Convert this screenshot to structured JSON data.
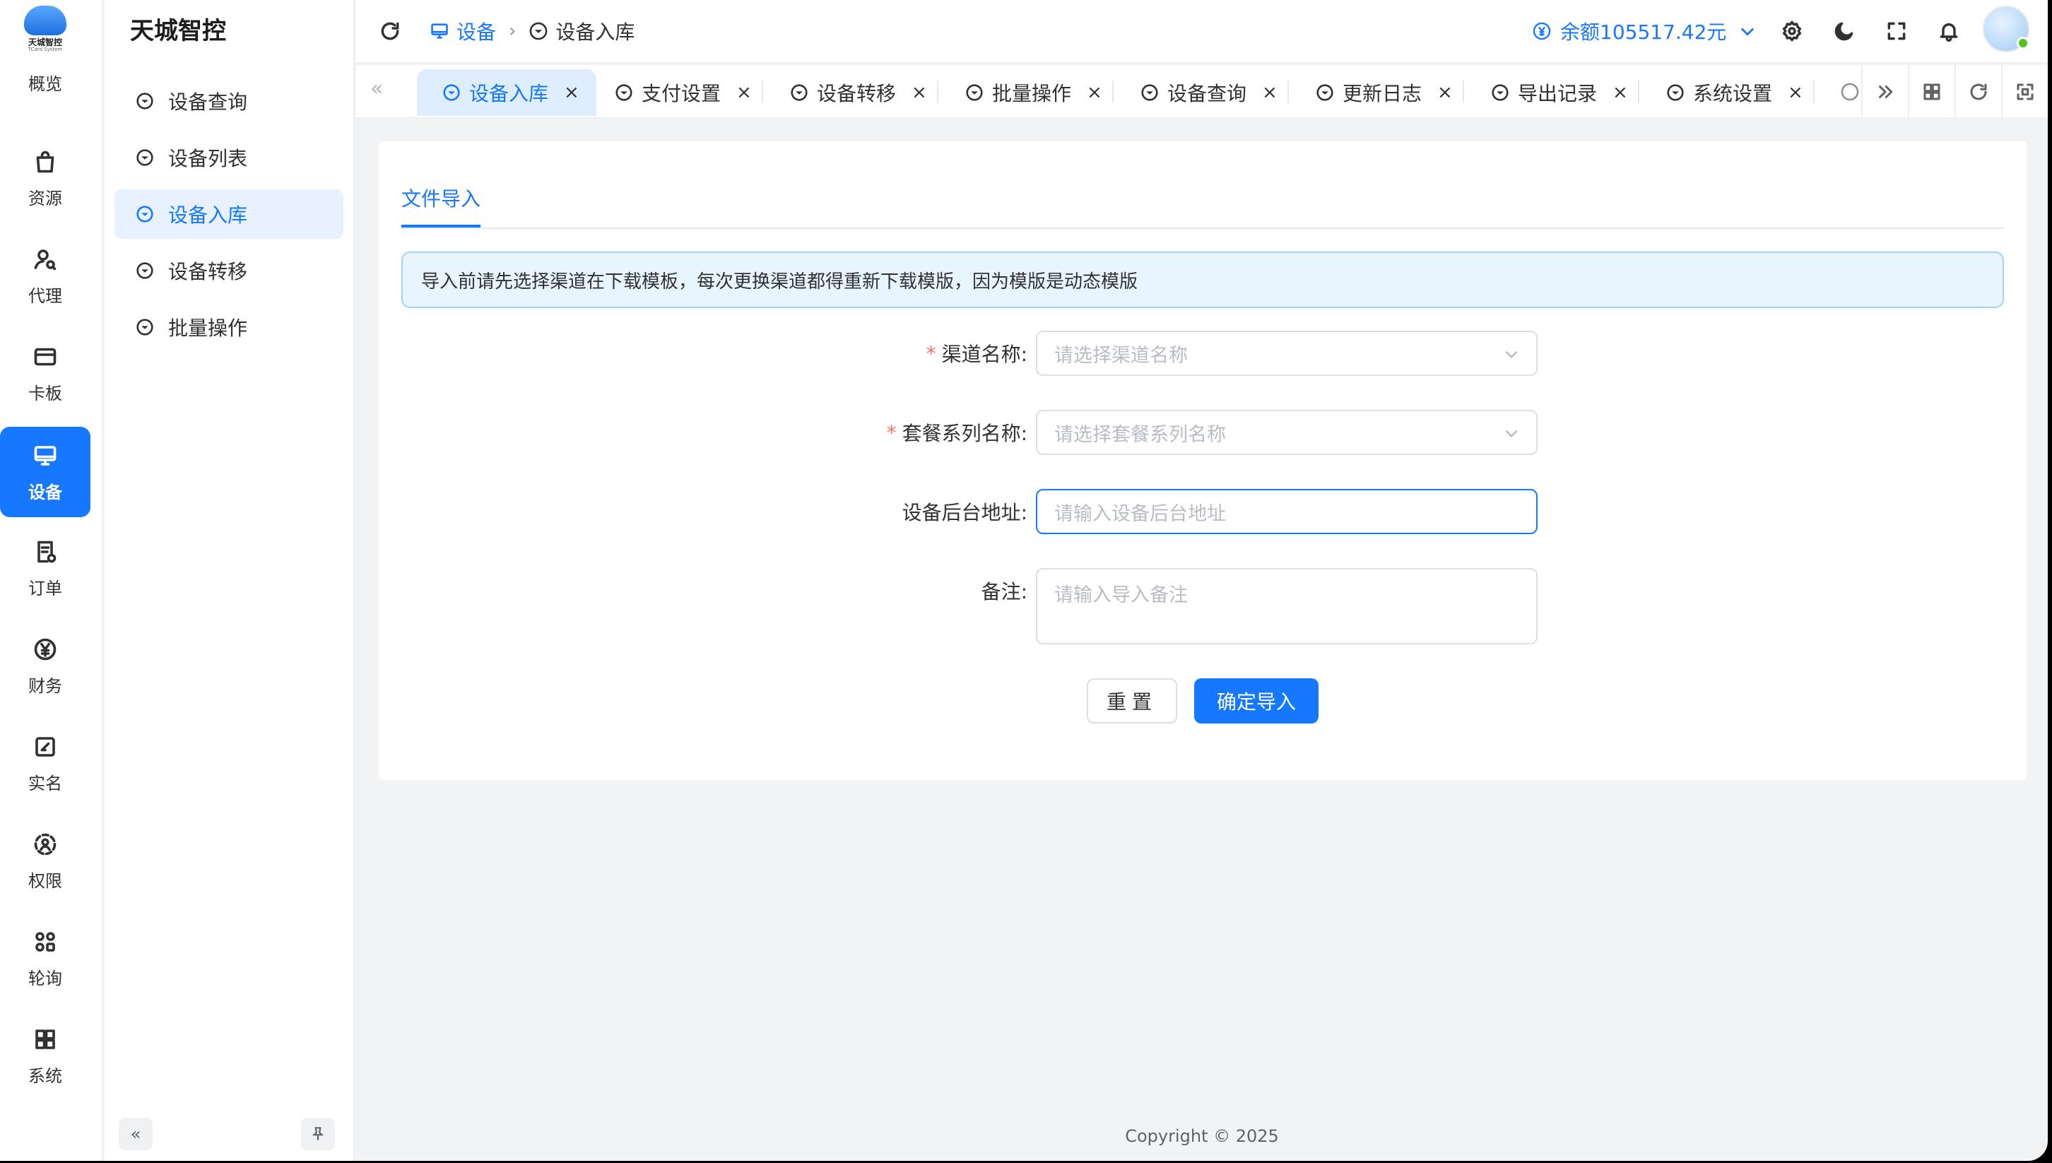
{
  "logo": {
    "title": "天城智控",
    "subtitle": "TCard System"
  },
  "rail": {
    "items": [
      {
        "label": "概览",
        "icon": "overview-icon"
      },
      {
        "label": "资源",
        "icon": "bag-icon"
      },
      {
        "label": "代理",
        "icon": "agent-icon"
      },
      {
        "label": "卡板",
        "icon": "card-icon"
      },
      {
        "label": "设备",
        "icon": "monitor-icon",
        "active": true
      },
      {
        "label": "订单",
        "icon": "order-icon"
      },
      {
        "label": "财务",
        "icon": "yen-icon"
      },
      {
        "label": "实名",
        "icon": "edit-icon"
      },
      {
        "label": "权限",
        "icon": "permission-icon"
      },
      {
        "label": "轮询",
        "icon": "poll-icon"
      },
      {
        "label": "系统",
        "icon": "grid-icon"
      }
    ]
  },
  "sidebar": {
    "brand": "天城智控",
    "items": [
      {
        "label": "设备查询"
      },
      {
        "label": "设备列表"
      },
      {
        "label": "设备入库",
        "active": true
      },
      {
        "label": "设备转移"
      },
      {
        "label": "批量操作"
      }
    ]
  },
  "header": {
    "breadcrumb": {
      "root": "设备",
      "current": "设备入库"
    },
    "balance": "余额105517.42元"
  },
  "tabs": [
    {
      "label": "设备入库",
      "active": true
    },
    {
      "label": "支付设置"
    },
    {
      "label": "设备转移"
    },
    {
      "label": "批量操作"
    },
    {
      "label": "设备查询"
    },
    {
      "label": "更新日志"
    },
    {
      "label": "导出记录"
    },
    {
      "label": "系统设置"
    }
  ],
  "page": {
    "tab": "文件导入",
    "alert": "导入前请先选择渠道在下载模板，每次更换渠道都得重新下载模版，因为模版是动态模版",
    "form": {
      "channel": {
        "label": "渠道名称:",
        "placeholder": "请选择渠道名称",
        "required": true
      },
      "package": {
        "label": "套餐系列名称:",
        "placeholder": "请选择套餐系列名称",
        "required": true
      },
      "backend": {
        "label": "设备后台地址:",
        "placeholder": "请输入设备后台地址"
      },
      "remark": {
        "label": "备注:",
        "placeholder": "请输入导入备注"
      }
    },
    "buttons": {
      "reset": "重置",
      "submit": "确定导入"
    }
  },
  "footer": "Copyright © 2025",
  "colors": {
    "primary": "#1677ff",
    "required": "#f56c6c",
    "alert_bg": "#e8f5ff"
  }
}
